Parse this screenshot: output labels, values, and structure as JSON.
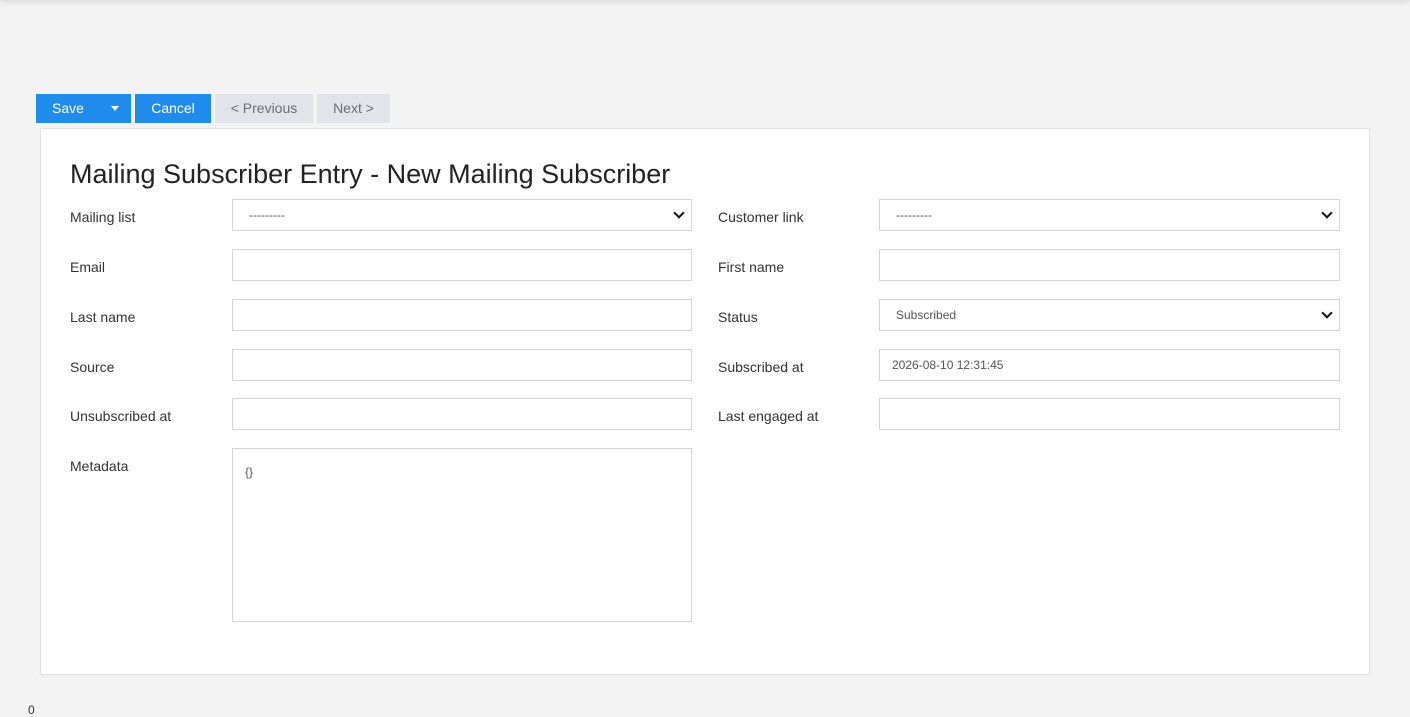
{
  "toolbar": {
    "save_label": "Save",
    "cancel_label": "Cancel",
    "previous_label": "< Previous",
    "next_label": "Next >"
  },
  "form": {
    "title": "Mailing Subscriber Entry - New Mailing Subscriber",
    "mailing_list": {
      "label": "Mailing list",
      "value": "---------"
    },
    "customer_link": {
      "label": "Customer link",
      "value": "---------"
    },
    "email": {
      "label": "Email",
      "value": ""
    },
    "first_name": {
      "label": "First name",
      "value": ""
    },
    "last_name": {
      "label": "Last name",
      "value": ""
    },
    "status": {
      "label": "Status",
      "value": "Subscribed"
    },
    "source": {
      "label": "Source",
      "value": ""
    },
    "subscribed_at": {
      "label": "Subscribed at",
      "value": "2026-08-10 12:31:45"
    },
    "unsubscribed_at": {
      "label": "Unsubscribed at",
      "value": ""
    },
    "last_engaged_at": {
      "label": "Last engaged at",
      "value": ""
    },
    "metadata": {
      "label": "Metadata",
      "value": "{}"
    }
  },
  "footer": {
    "stray_text": "0"
  },
  "colors": {
    "primary": "#1f8ceb",
    "disabled_bg": "#e1e4e8",
    "page_bg": "#f3f3f3"
  }
}
